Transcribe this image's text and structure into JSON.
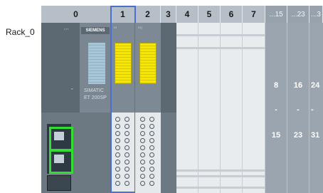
{
  "rack": {
    "name": "Rack_0"
  },
  "slots": {
    "s0": "0",
    "s1": "1",
    "s2": "2",
    "s3": "3",
    "s4": "4",
    "s5": "5",
    "s6": "6",
    "s7": "7",
    "e15": "...15",
    "e23": "...23",
    "e3x": "...3"
  },
  "ext_columns": [
    {
      "top": "8",
      "sep": "-",
      "bottom": "15"
    },
    {
      "top": "16",
      "sep": "-",
      "bottom": "23"
    },
    {
      "top": "24",
      "sep": "-",
      "bottom": "31"
    }
  ],
  "modules": {
    "cpu": {
      "brand": "SIEMENS",
      "line1": "SIMATIC",
      "line2": "ET 200SP"
    },
    "module1": {
      "type": "DI"
    },
    "module2": {
      "type": "DQ"
    }
  },
  "colors": {
    "selection": "#4a6fd1",
    "highlight_port": "#33dd33",
    "io_yellow": "#f7e600"
  }
}
